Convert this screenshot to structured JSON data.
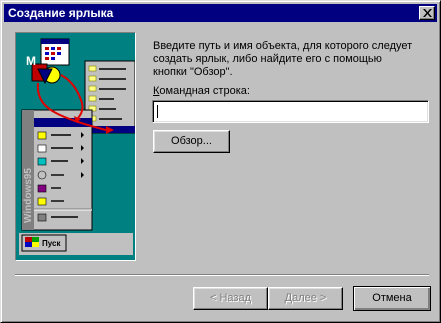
{
  "window": {
    "title": "Создание ярлыка"
  },
  "prompt": {
    "lines": [
      "Введите путь и имя объекта, для которого следует",
      "создать ярлык, либо найдите его с помощью",
      "кнопки \"Обзор\"."
    ]
  },
  "command_line": {
    "label_prefix": "К",
    "label_rest": "омандная строка:",
    "value": ""
  },
  "buttons": {
    "browse": "Обзор...",
    "back": "< Назад",
    "next": "Далее >",
    "cancel": "Отмена"
  },
  "illustration": {
    "start_menu_side_text": "Windows95",
    "taskbar_start": "Пуск"
  },
  "colors": {
    "title_bar": "#000080",
    "desktop": "#008080",
    "face": "#c0c0c0",
    "arrow": "#e00000"
  }
}
